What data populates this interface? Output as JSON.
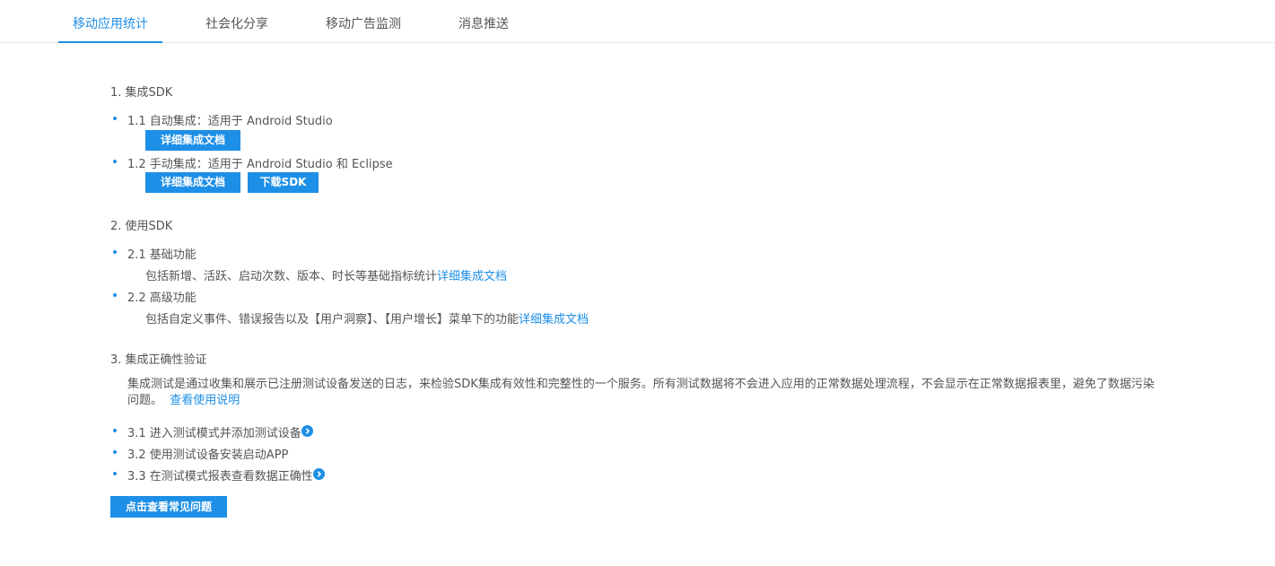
{
  "tabs": [
    {
      "label": "移动应用统计"
    },
    {
      "label": "社会化分享"
    },
    {
      "label": "移动广告监测"
    },
    {
      "label": "消息推送"
    }
  ],
  "section1": {
    "title": "1.  集成SDK",
    "item1": {
      "label": "1.1 自动集成：适用于 Android Studio",
      "doc_button": "详细集成文档"
    },
    "item2": {
      "label": "1.2 手动集成：适用于 Android Studio 和 Eclipse",
      "doc_button": "详细集成文档",
      "download_button": "下载SDK"
    }
  },
  "section2": {
    "title": "2.  使用SDK",
    "item1": {
      "label": "2.1 基础功能",
      "desc": "包括新增、活跃、启动次数、版本、时长等基础指标统计",
      "link": "详细集成文档"
    },
    "item2": {
      "label": "2.2 高级功能",
      "desc": "包括自定义事件、错误报告以及【用户洞察】、【用户增长】菜单下的功能",
      "link": "详细集成文档"
    }
  },
  "section3": {
    "title": "3.  集成正确性验证",
    "paragraph": "集成测试是通过收集和展示已注册测试设备发送的日志，来检验SDK集成有效性和完整性的一个服务。所有测试数据将不会进入应用的正常数据处理流程，不会显示在正常数据报表里，避免了数据污染问题。",
    "paragraph_link": "查看使用说明",
    "steps": [
      {
        "label": "3.1 进入测试模式并添加测试设备",
        "icon": "chevron-right-circle-icon"
      },
      {
        "label": "3.2 使用测试设备安装启动APP"
      },
      {
        "label": "3.3 在测试模式报表查看数据正确性",
        "icon": "chevron-right-circle-icon"
      }
    ]
  },
  "faq_button": "点击查看常见问题",
  "accent_color": "#1e8fe6"
}
